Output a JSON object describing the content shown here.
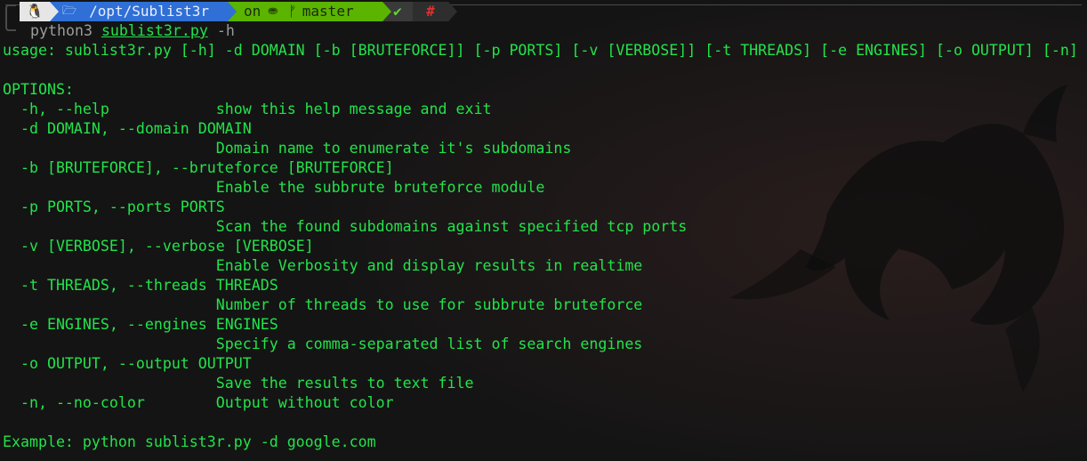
{
  "prompt": {
    "os_icon": "linux-tux-icon",
    "os_glyph": "🐧",
    "folder_icon": "folder-icon",
    "folder_glyph": "🗁",
    "path": "/opt/Sublist3r",
    "on_label": "on",
    "git_icon": "github-icon",
    "git_glyph": "⛂",
    "branch_icon": "branch-icon",
    "branch_glyph": "ᚠ",
    "branch": "master",
    "status_ok": "✔",
    "status_hash": "#",
    "colors": {
      "dir_bg": "#2f6fd6",
      "git_bg": "#5ab400",
      "os_bg": "#e6e6e6",
      "hash": "#e03030"
    }
  },
  "command": {
    "program": "python3",
    "script": "sublist3r.py",
    "args": "-h"
  },
  "output": {
    "usage": "usage: sublist3r.py [-h] -d DOMAIN [-b [BRUTEFORCE]] [-p PORTS] [-v [VERBOSE]] [-t THREADS] [-e ENGINES] [-o OUTPUT] [-n]",
    "options_header": "OPTIONS:",
    "options": [
      {
        "flag": "  -h, --help            show this help message and exit"
      },
      {
        "flag": "  -d DOMAIN, --domain DOMAIN"
      },
      {
        "flag": "                        Domain name to enumerate it's subdomains"
      },
      {
        "flag": "  -b [BRUTEFORCE], --bruteforce [BRUTEFORCE]"
      },
      {
        "flag": "                        Enable the subbrute bruteforce module"
      },
      {
        "flag": "  -p PORTS, --ports PORTS"
      },
      {
        "flag": "                        Scan the found subdomains against specified tcp ports"
      },
      {
        "flag": "  -v [VERBOSE], --verbose [VERBOSE]"
      },
      {
        "flag": "                        Enable Verbosity and display results in realtime"
      },
      {
        "flag": "  -t THREADS, --threads THREADS"
      },
      {
        "flag": "                        Number of threads to use for subbrute bruteforce"
      },
      {
        "flag": "  -e ENGINES, --engines ENGINES"
      },
      {
        "flag": "                        Specify a comma-separated list of search engines"
      },
      {
        "flag": "  -o OUTPUT, --output OUTPUT"
      },
      {
        "flag": "                        Save the results to text file"
      },
      {
        "flag": "  -n, --no-color        Output without color"
      }
    ],
    "example": "Example: python sublist3r.py -d google.com"
  },
  "colors": {
    "text": "#22e34a",
    "background": "#151515"
  }
}
